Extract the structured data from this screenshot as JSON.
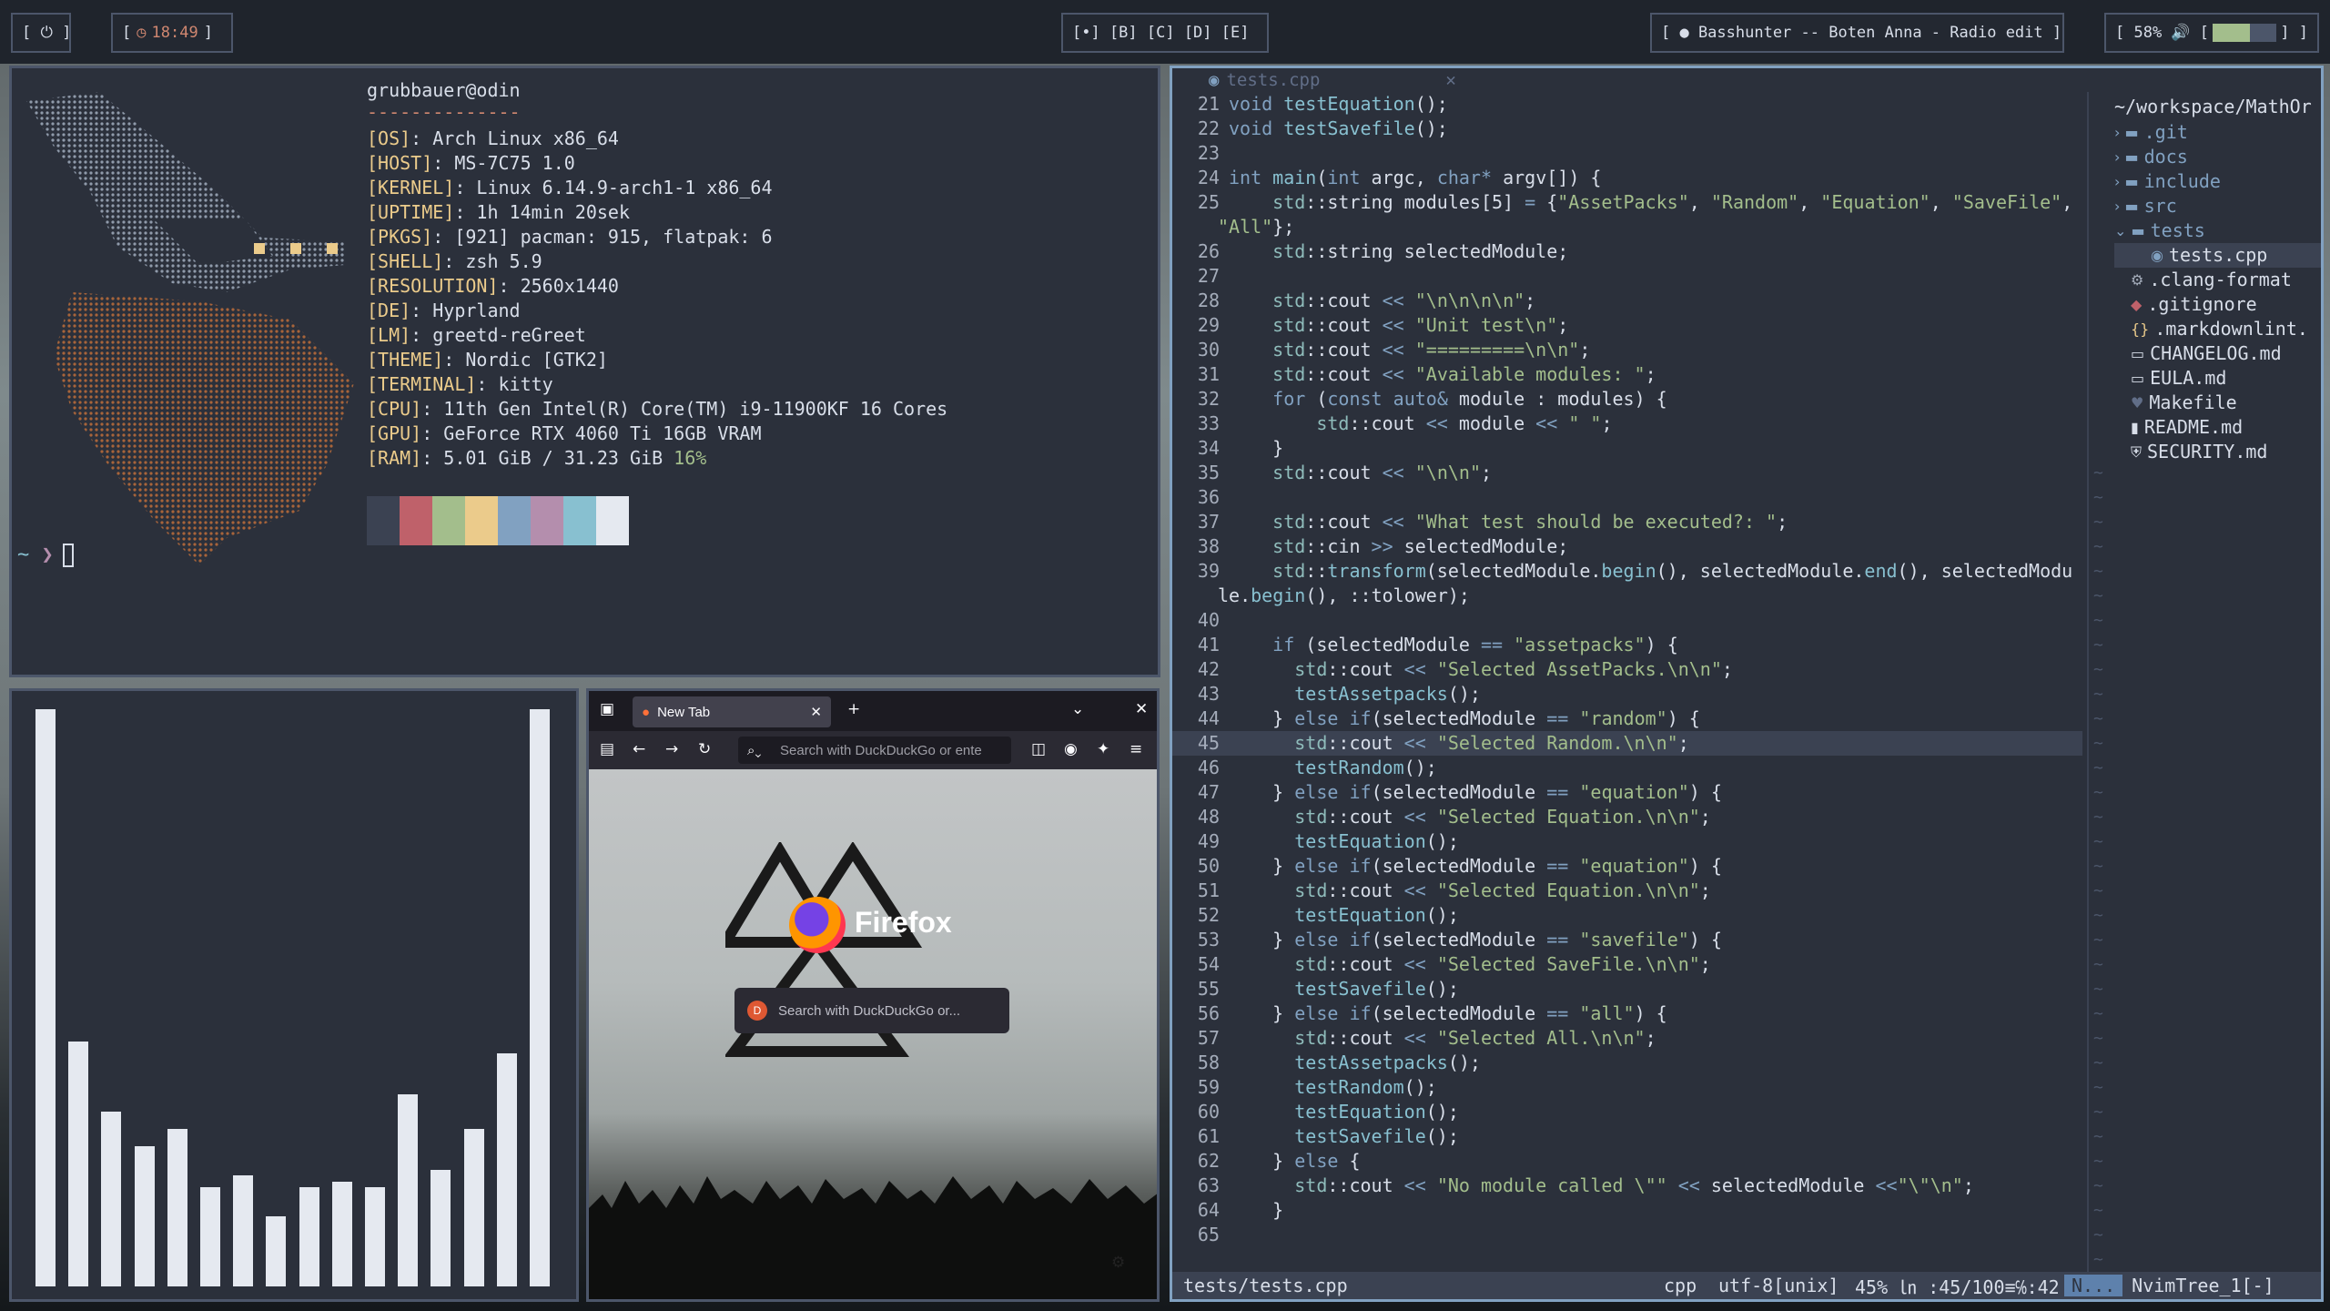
{
  "topbar": {
    "power": "[ ⏻ ]",
    "clock_open": "[",
    "clock_time": "18:49",
    "clock_close": "]",
    "workspaces": "[•] [B] [C] [D] [E]",
    "media": "[ ● Basshunter -- Boten Anna - Radio edit ]",
    "volume": "[ 58% 🔊 [",
    "volume_close": "] ]",
    "volume_level": 0.58
  },
  "neofetch": {
    "user_host": "grubbauer@odin",
    "separator": "--------------",
    "lines": [
      {
        "key": "[OS]",
        "value": ": Arch Linux x86_64"
      },
      {
        "key": "[HOST]",
        "value": ": MS-7C75 1.0"
      },
      {
        "key": "[KERNEL]",
        "value": ": Linux 6.14.9-arch1-1 x86_64"
      },
      {
        "key": "[UPTIME]",
        "value": ": 1h 14min 20sek"
      },
      {
        "key": "[PKGS]",
        "value": ": [921] pacman: 915, flatpak: 6"
      },
      {
        "key": "[SHELL]",
        "value": ": zsh 5.9"
      },
      {
        "key": "[RESOLUTION]",
        "value": ": 2560x1440"
      },
      {
        "key": "[DE]",
        "value": ": Hyprland"
      },
      {
        "key": "[LM]",
        "value": ": greetd-reGreet"
      },
      {
        "key": "[THEME]",
        "value": ": Nordic [GTK2]"
      },
      {
        "key": "[TERMINAL]",
        "value": ": kitty"
      },
      {
        "key": "[CPU]",
        "value": ": 11th Gen Intel(R) Core(TM) i9-11900KF 16 Cores"
      },
      {
        "key": "[GPU]",
        "value": ": GeForce RTX 4060 Ti 16GB  VRAM"
      },
      {
        "key": "[RAM]",
        "value": ": 5.01 GiB / 31.23 GiB"
      }
    ],
    "ram_percent": "16%",
    "palette": [
      "#3b4252",
      "#bf616a",
      "#a3be8c",
      "#ebcb8b",
      "#81a1c1",
      "#b48ead",
      "#88c0d0",
      "#e5e9f0"
    ],
    "prompt_tilde": "~",
    "prompt_arrow": "❯"
  },
  "visualizer": {
    "levels": [
      0.99,
      0.42,
      0.3,
      0.24,
      0.27,
      0.17,
      0.19,
      0.12,
      0.17,
      0.18,
      0.17,
      0.33,
      0.2,
      0.27,
      0.4,
      0.99
    ]
  },
  "firefox": {
    "tab_title": "New Tab",
    "url_placeholder": "Search with DuckDuckGo or ente",
    "brand": "Firefox",
    "search_placeholder": "Search with DuckDuckGo or..."
  },
  "editor": {
    "tab_title": "tests.cpp",
    "status_file": "tests/tests.cpp",
    "status_ft": "cpp",
    "status_enc": "utf-8[unix]",
    "status_pos": "45% ㏑ :45/100≡℅:42",
    "status_mode": "N...",
    "status_tree": "NvimTree_1[-]",
    "tree_root": "~/workspace/MathOr",
    "tree": [
      {
        "icon": ">",
        "name": ".git",
        "kind": "dir"
      },
      {
        "icon": ">",
        "name": "docs",
        "kind": "dir"
      },
      {
        "icon": ">",
        "name": "include",
        "kind": "dir"
      },
      {
        "icon": ">",
        "name": "src",
        "kind": "dir"
      },
      {
        "icon": "v",
        "name": "tests",
        "kind": "dir"
      },
      {
        "icon": "",
        "name": "tests.cpp",
        "kind": "sel"
      },
      {
        "icon": "",
        "name": ".clang-format",
        "kind": "file"
      },
      {
        "icon": "",
        "name": ".gitignore",
        "kind": "file"
      },
      {
        "icon": "",
        "name": ".markdownlint.",
        "kind": "file"
      },
      {
        "icon": "",
        "name": "CHANGELOG.md",
        "kind": "file"
      },
      {
        "icon": "",
        "name": "EULA.md",
        "kind": "file"
      },
      {
        "icon": "",
        "name": "Makefile",
        "kind": "file"
      },
      {
        "icon": "",
        "name": "README.md",
        "kind": "file"
      },
      {
        "icon": "",
        "name": "SECURITY.md",
        "kind": "file"
      }
    ],
    "code": [
      {
        "n": "21",
        "t": "void testEquation();"
      },
      {
        "n": "22",
        "t": "void testSavefile();"
      },
      {
        "n": "23",
        "t": ""
      },
      {
        "n": "24",
        "t": "int main(int argc, char* argv[]) {"
      },
      {
        "n": "25",
        "t": "    std::string modules[5] = {\"AssetPacks\", \"Random\", \"Equation\", \"SaveFile\","
      },
      {
        "n": "",
        "t": "\"All\"};"
      },
      {
        "n": "26",
        "t": "    std::string selectedModule;"
      },
      {
        "n": "27",
        "t": ""
      },
      {
        "n": "28",
        "t": "    std::cout << \"\\n\\n\\n\\n\";"
      },
      {
        "n": "29",
        "t": "    std::cout << \"Unit test\\n\";"
      },
      {
        "n": "30",
        "t": "    std::cout << \"=========\\n\\n\";"
      },
      {
        "n": "31",
        "t": "    std::cout << \"Available modules: \";"
      },
      {
        "n": "32",
        "t": "    for (const auto& module : modules) {"
      },
      {
        "n": "33",
        "t": "        std::cout << module << \" \";"
      },
      {
        "n": "34",
        "t": "    }"
      },
      {
        "n": "35",
        "t": "    std::cout << \"\\n\\n\";"
      },
      {
        "n": "36",
        "t": ""
      },
      {
        "n": "37",
        "t": "    std::cout << \"What test should be executed?: \";"
      },
      {
        "n": "38",
        "t": "    std::cin >> selectedModule;"
      },
      {
        "n": "39",
        "t": "    std::transform(selectedModule.begin(), selectedModule.end(), selectedModu"
      },
      {
        "n": "",
        "t": "le.begin(), ::tolower);"
      },
      {
        "n": "40",
        "t": ""
      },
      {
        "n": "41",
        "t": "    if (selectedModule == \"assetpacks\") {"
      },
      {
        "n": "42",
        "t": "      std::cout << \"Selected AssetPacks.\\n\\n\";"
      },
      {
        "n": "43",
        "t": "      testAssetpacks();"
      },
      {
        "n": "44",
        "t": "    } else if(selectedModule == \"random\") {"
      },
      {
        "n": "45",
        "t": "      std::cout << \"Selected Random.\\n\\n\";"
      },
      {
        "n": "46",
        "t": "      testRandom();"
      },
      {
        "n": "47",
        "t": "    } else if(selectedModule == \"equation\") {"
      },
      {
        "n": "48",
        "t": "      std::cout << \"Selected Equation.\\n\\n\";"
      },
      {
        "n": "49",
        "t": "      testEquation();"
      },
      {
        "n": "50",
        "t": "    } else if(selectedModule == \"equation\") {"
      },
      {
        "n": "51",
        "t": "      std::cout << \"Selected Equation.\\n\\n\";"
      },
      {
        "n": "52",
        "t": "      testEquation();"
      },
      {
        "n": "53",
        "t": "    } else if(selectedModule == \"savefile\") {"
      },
      {
        "n": "54",
        "t": "      std::cout << \"Selected SaveFile.\\n\\n\";"
      },
      {
        "n": "55",
        "t": "      testSavefile();"
      },
      {
        "n": "56",
        "t": "    } else if(selectedModule == \"all\") {"
      },
      {
        "n": "57",
        "t": "      std::cout << \"Selected All.\\n\\n\";"
      },
      {
        "n": "58",
        "t": "      testAssetpacks();"
      },
      {
        "n": "59",
        "t": "      testRandom();"
      },
      {
        "n": "60",
        "t": "      testEquation();"
      },
      {
        "n": "61",
        "t": "      testSavefile();"
      },
      {
        "n": "62",
        "t": "    } else {"
      },
      {
        "n": "63",
        "t": "      std::cout << \"No module called \\\"\" << selectedModule <<\"\\\"\\n\";"
      },
      {
        "n": "64",
        "t": "    }"
      },
      {
        "n": "65",
        "t": ""
      }
    ],
    "highlight_line": "45"
  }
}
